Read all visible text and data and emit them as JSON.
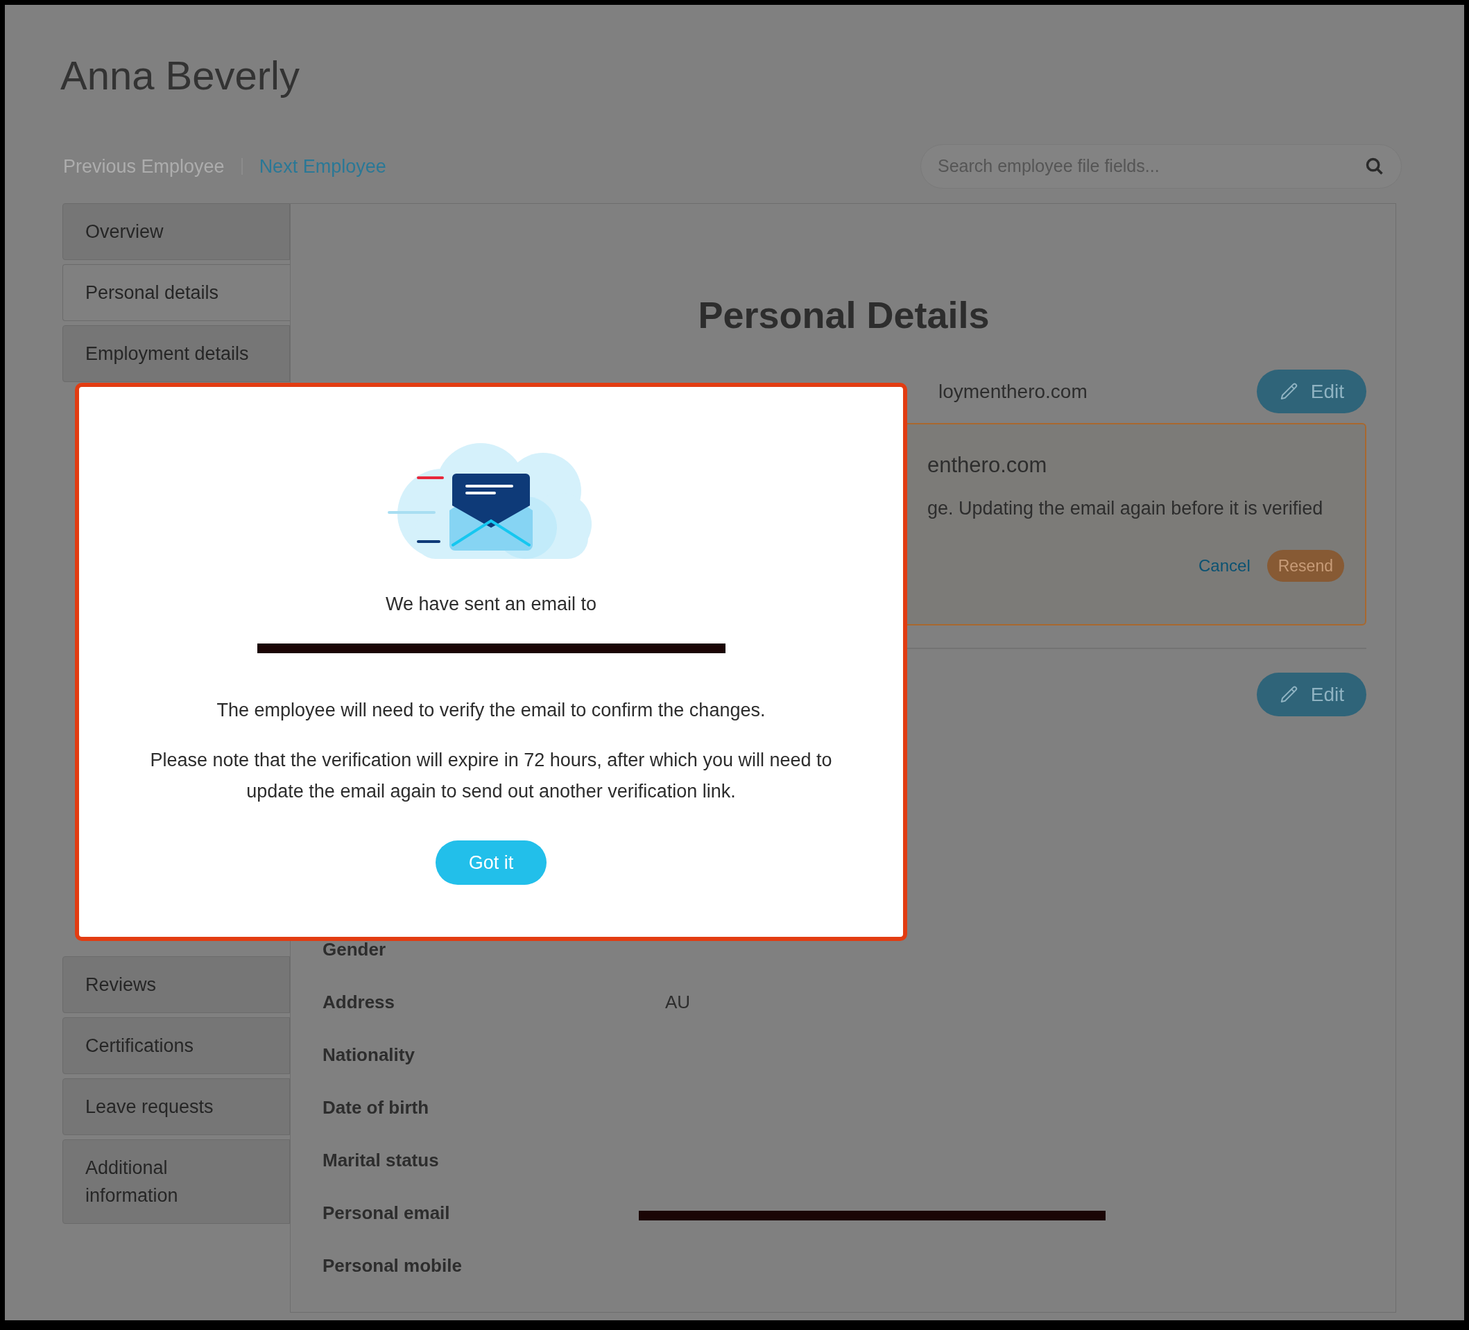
{
  "employee": {
    "name": "Anna Beverly"
  },
  "nav": [
    {
      "label": "Previous Employee",
      "disabled": true
    },
    {
      "label": "Next Employee",
      "disabled": false
    }
  ],
  "search": {
    "placeholder": "Search employee file fields..."
  },
  "sidebar": {
    "items_top": [
      {
        "label": "Overview",
        "selected": false
      },
      {
        "label": "Personal details",
        "selected": true
      },
      {
        "label": "Employment details",
        "selected": false
      }
    ],
    "items_bottom": [
      {
        "label": "Reviews",
        "selected": false
      },
      {
        "label": "Certifications",
        "selected": false
      },
      {
        "label": "Leave requests",
        "selected": false
      },
      {
        "label": "Additional information",
        "selected": false
      }
    ]
  },
  "section": {
    "title": "Personal Details",
    "email_row": {
      "value": "loymenthero.com",
      "button": "Edit"
    },
    "pending": {
      "email": "enthero.com",
      "message": "ge. Updating the email again before it is verified",
      "cancel": "Cancel",
      "resend": "Resend"
    },
    "second_edit": "Edit",
    "fields": [
      {
        "label": "Gender"
      },
      {
        "label": "Address",
        "value": "AU"
      },
      {
        "label": "Nationality"
      },
      {
        "label": "Date of birth"
      },
      {
        "label": "Marital status"
      },
      {
        "label": "Personal email",
        "redacted": true
      },
      {
        "label": "Personal mobile"
      }
    ]
  },
  "modal": {
    "intro": "We have sent an email to",
    "recipient_redacted": true,
    "message": "The employee will need to verify the email to confirm the changes.",
    "note": "Please note that the verification will expire in 72 hours, after which you will need to update the email again to send out another verification link.",
    "button": "Got it"
  }
}
